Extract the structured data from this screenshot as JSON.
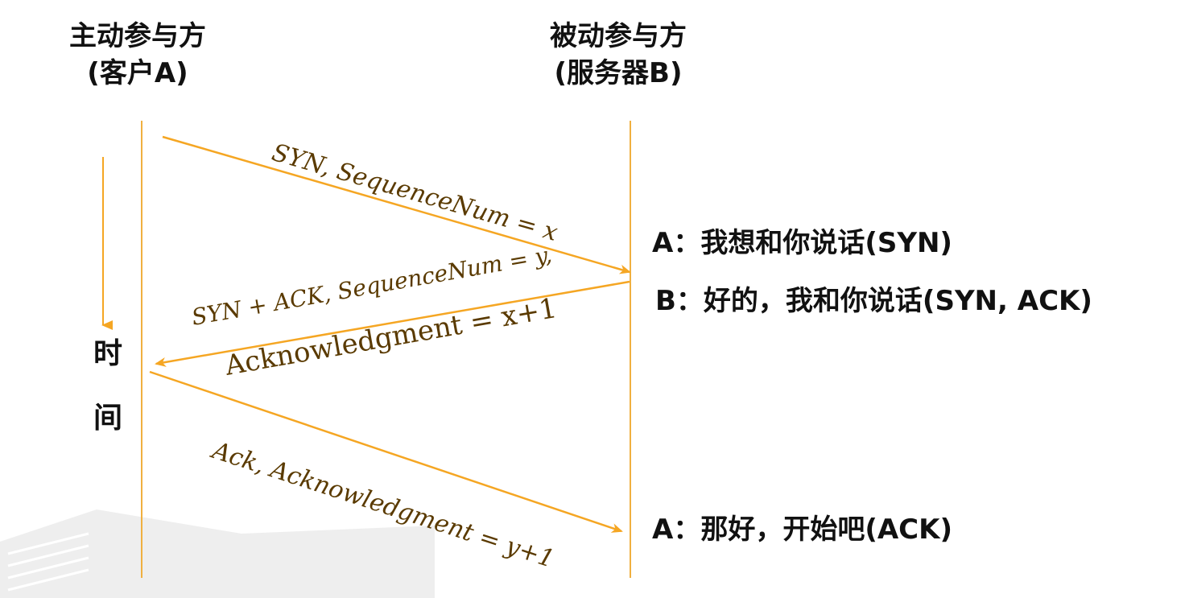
{
  "participants": {
    "a": {
      "line1": "主动参与方",
      "line2": "(客户A)"
    },
    "b": {
      "line1": "被动参与方",
      "line2": "(服务器B)"
    }
  },
  "time_axis": {
    "char1": "时",
    "char2": "间"
  },
  "messages": [
    {
      "label": "SYN, SequenceNum = x"
    },
    {
      "label_line1": "SYN + ACK, SequenceNum = y,",
      "label_line2": "Acknowledgment = x+1"
    },
    {
      "label": "Ack, Acknowledgment = y+1"
    }
  ],
  "dialogue": [
    "A：我想和你说话(SYN)",
    "B：好的，我和你说话(SYN, ACK)",
    "A：那好，开始吧(ACK)"
  ],
  "colors": {
    "arrow": "#f5a623",
    "lifeline": "#f0b040",
    "label_text": "#5a3a00",
    "text": "#111111"
  }
}
